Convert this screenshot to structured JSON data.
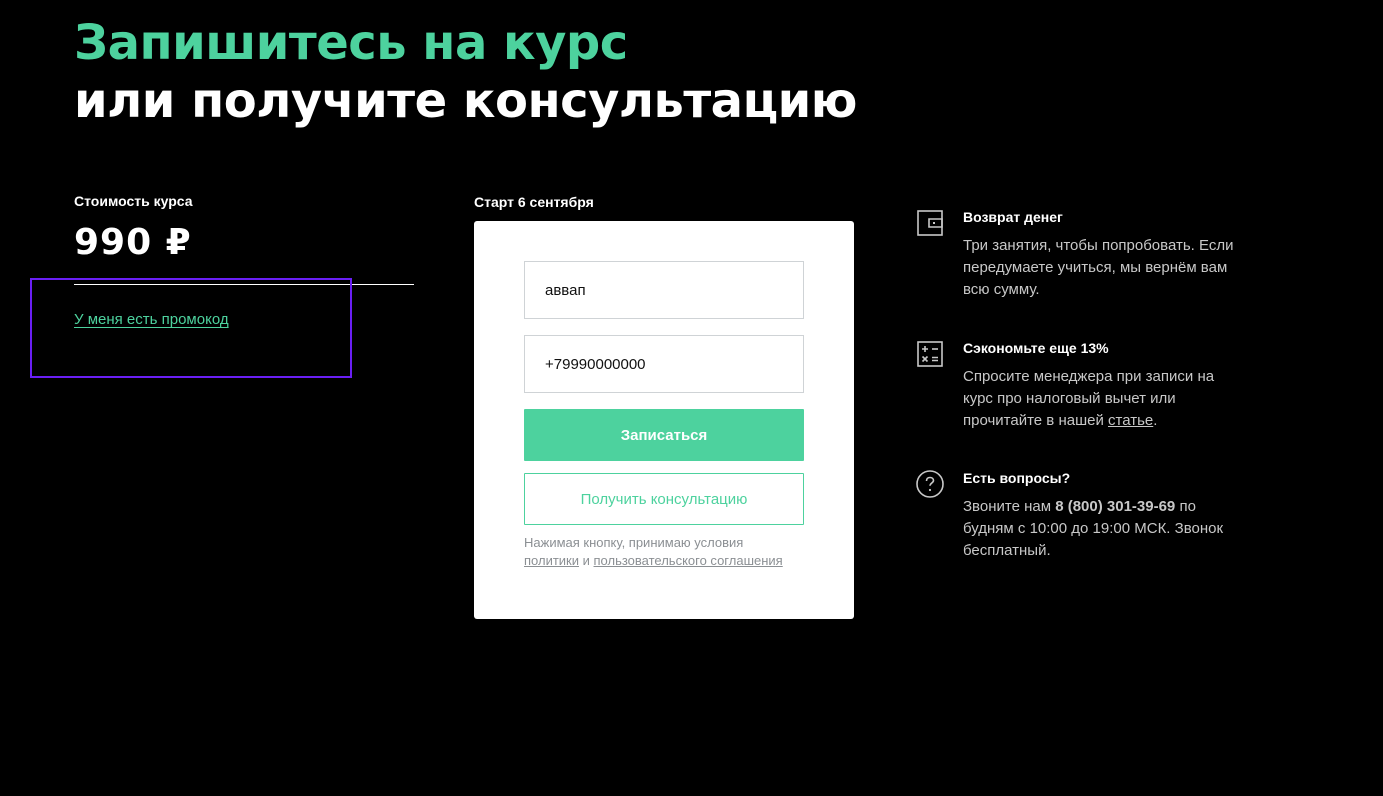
{
  "heading": {
    "line1": "Запишитесь на курс",
    "line2": "или получите консультацию"
  },
  "price": {
    "label": "Стоимость курса",
    "value": "990 ₽",
    "promo_link": "У меня есть промокод"
  },
  "form": {
    "start_label": "Старт 6 сентября",
    "name_value": "аввап",
    "phone_value": "+79990000000",
    "submit_label": "Записаться",
    "consult_label": "Получить консультацию",
    "consent_prefix": "Нажимая кнопку, принимаю условия",
    "consent_policy_link": "политики",
    "consent_and": "и",
    "consent_agreement_link": "пользовательского соглашения"
  },
  "benefits": [
    {
      "icon": "wallet-icon",
      "title": "Возврат денег",
      "text": "Три занятия, чтобы попробовать. Если передумаете учиться, мы вернём вам всю сумму."
    },
    {
      "icon": "calculator-icon",
      "title": "Сэкономьте еще 13%",
      "text_before": "Спросите менеджера при записи на курс про налоговый вычет или прочитайте в нашей",
      "link": "статье",
      "text_after": "."
    },
    {
      "icon": "question-icon",
      "title": "Есть вопросы?",
      "text_before": "Звоните нам",
      "phone": "8 (800) 301-39-69",
      "text_after": "по будням с 10:00 до 19:00 МСК. Звонок бесплатный."
    }
  ],
  "colors": {
    "accent": "#4dd29e",
    "background": "#000000",
    "highlight": "#6a1ff5"
  }
}
